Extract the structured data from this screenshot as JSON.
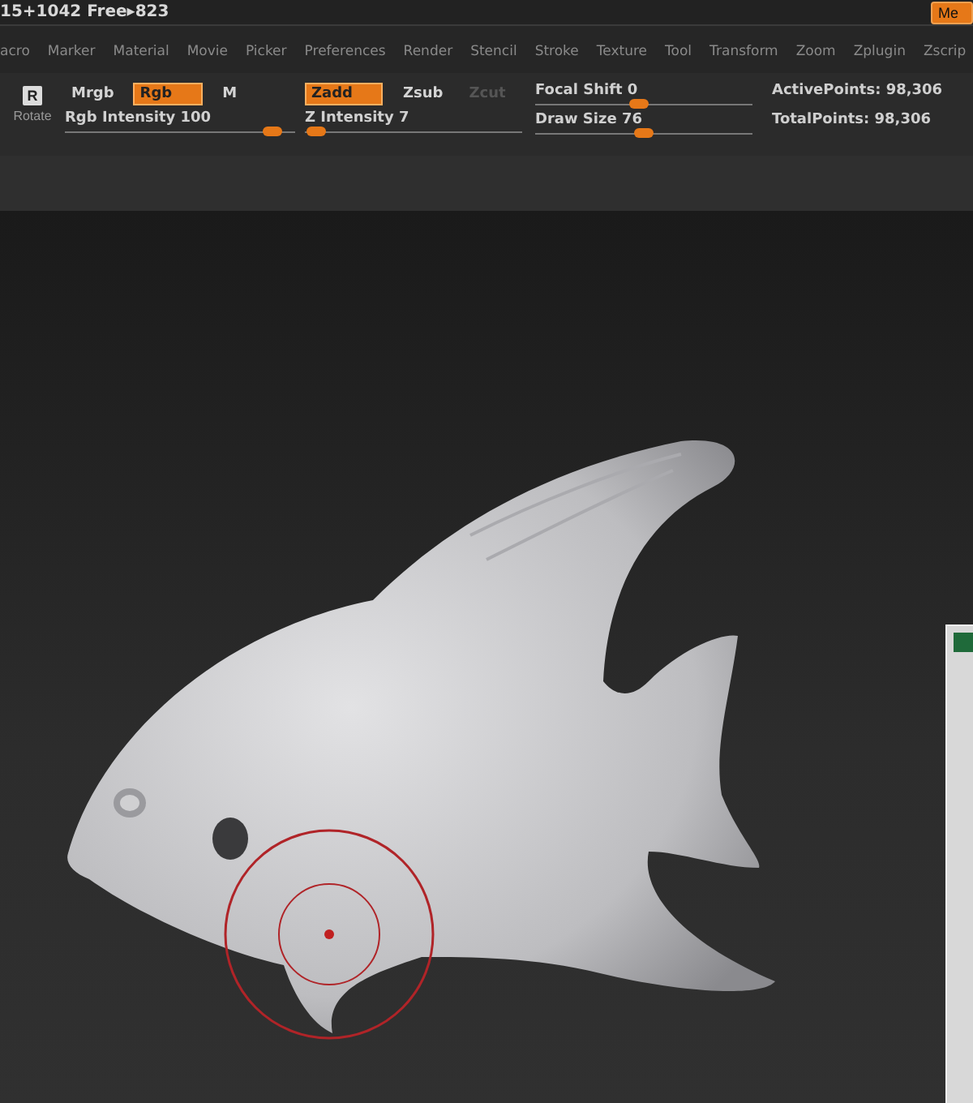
{
  "title_bar": {
    "text": "15+1042 Free▸823",
    "corner_button": "Me"
  },
  "menu": [
    "acro",
    "Marker",
    "Material",
    "Movie",
    "Picker",
    "Preferences",
    "Render",
    "Stencil",
    "Stroke",
    "Texture",
    "Tool",
    "Transform",
    "Zoom",
    "Zplugin",
    "Zscrip"
  ],
  "toolbar": {
    "rotate": {
      "key": "R",
      "label": "Rotate"
    },
    "rgb_modes": [
      {
        "label": "Mrgb",
        "selected": false,
        "disabled": false
      },
      {
        "label": "Rgb",
        "selected": true,
        "disabled": false
      },
      {
        "label": "M",
        "selected": false,
        "disabled": false
      }
    ],
    "z_modes": [
      {
        "label": "Zadd",
        "selected": true,
        "disabled": false
      },
      {
        "label": "Zsub",
        "selected": false,
        "disabled": false
      },
      {
        "label": "Zcut",
        "selected": false,
        "disabled": true
      }
    ],
    "sliders_left": [
      {
        "label": "Rgb Intensity 100",
        "level": 0.9
      },
      {
        "label": "Z Intensity 7",
        "level": 0.05
      }
    ],
    "sliders_right": [
      {
        "label": "Focal Shift 0",
        "level": 0.48
      },
      {
        "label": "Draw Size 76",
        "level": 0.5
      }
    ],
    "stats": [
      "ActivePoints: 98,306",
      "TotalPoints: 98,306"
    ]
  }
}
